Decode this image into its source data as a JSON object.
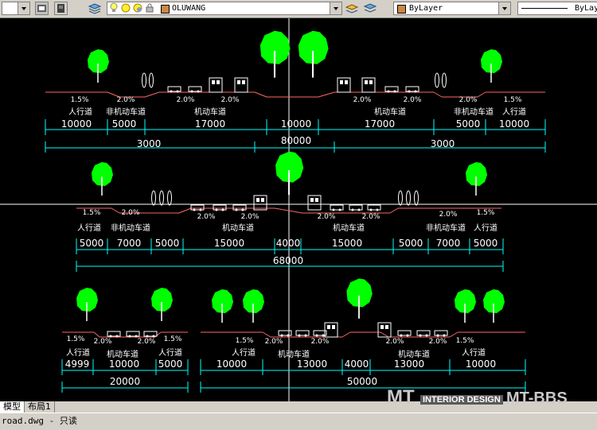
{
  "toolbar": {
    "layer_name": "OLUWANG",
    "color_value": "ByLayer",
    "linetype_value": "ByLay",
    "icons": [
      "chevron-down-icon",
      "layer-states-icon",
      "layers-icon",
      "lightbulb-icon",
      "sun-icon",
      "lock-icon",
      "color-swatch-icon",
      "layer-previous-icon",
      "make-current-icon"
    ]
  },
  "tabs": {
    "model": "模型",
    "layout1": "布局1"
  },
  "status": {
    "file": "road.dwg - 只读"
  },
  "watermark": {
    "left": "MT",
    "mid": "INTERIOR DESIGN",
    "right": "MT-BBS"
  },
  "colors": {
    "background": "#000000",
    "tree": "#00ff00",
    "dimension": "#00ffff",
    "text": "#ffffff",
    "ground": "#ff6666"
  },
  "sections": [
    {
      "name": "section-80m",
      "slopes": [
        "1.5%",
        "2.0%",
        "2.0%",
        "2.0%",
        "2.0%",
        "2.0%",
        "2.0%",
        "1.5%"
      ],
      "lane_labels": [
        "人行道",
        "非机动车道",
        "机动车道",
        "机动车道",
        "非机动车道",
        "人行道"
      ],
      "dims": [
        "10000",
        "5000",
        "17000",
        "10000",
        "17000",
        "5000",
        "10000"
      ],
      "sub_dims": [
        "3000",
        "3000"
      ],
      "total": "80000"
    },
    {
      "name": "section-68m",
      "slopes": [
        "1.5%",
        "2.0%",
        "2.0%",
        "2.0%",
        "2.0%",
        "2.0%",
        "2.0%",
        "1.5%"
      ],
      "lane_labels": [
        "人行道",
        "非机动车道",
        "机动车道",
        "机动车道",
        "非机动车道",
        "人行道"
      ],
      "dims": [
        "5000",
        "7000",
        "5000",
        "15000",
        "4000",
        "15000",
        "5000",
        "7000",
        "5000"
      ],
      "total": "68000"
    },
    {
      "name": "section-20m",
      "slopes": [
        "1.5%",
        "2.0%",
        "2.0%",
        "1.5%"
      ],
      "lane_labels": [
        "人行道",
        "机动车道",
        "人行道"
      ],
      "dims": [
        "4999",
        "10000",
        "5000"
      ],
      "total": "20000"
    },
    {
      "name": "section-50m",
      "slopes": [
        "1.5%",
        "2.0%",
        "2.0%",
        "2.0%",
        "2.0%",
        "1.5%"
      ],
      "lane_labels": [
        "人行道",
        "机动车道",
        "机动车道",
        "人行道"
      ],
      "dims": [
        "10000",
        "13000",
        "4000",
        "13000",
        "10000"
      ],
      "total": "50000"
    }
  ]
}
